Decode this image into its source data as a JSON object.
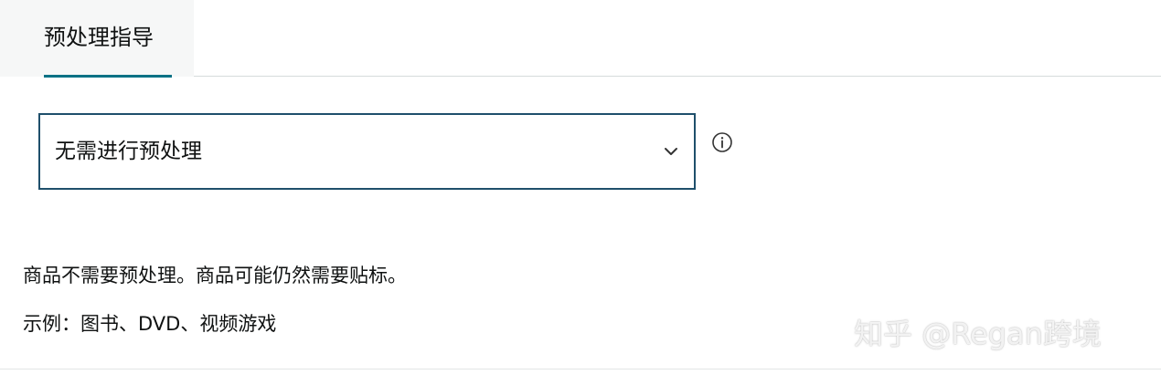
{
  "tabs": {
    "active_label": "预处理指导"
  },
  "select": {
    "value": "无需进行预处理"
  },
  "description": "商品不需要预处理。商品可能仍然需要贴标。",
  "example": "示例：图书、DVD、视频游戏",
  "watermark": "知乎 @Regan跨境",
  "colors": {
    "accent": "#007185",
    "select_border": "#1f4f6b",
    "text": "#0f1111",
    "divider": "#d5dbdb"
  },
  "icons": {
    "dropdown": "chevron-down-icon",
    "info": "info-icon"
  }
}
